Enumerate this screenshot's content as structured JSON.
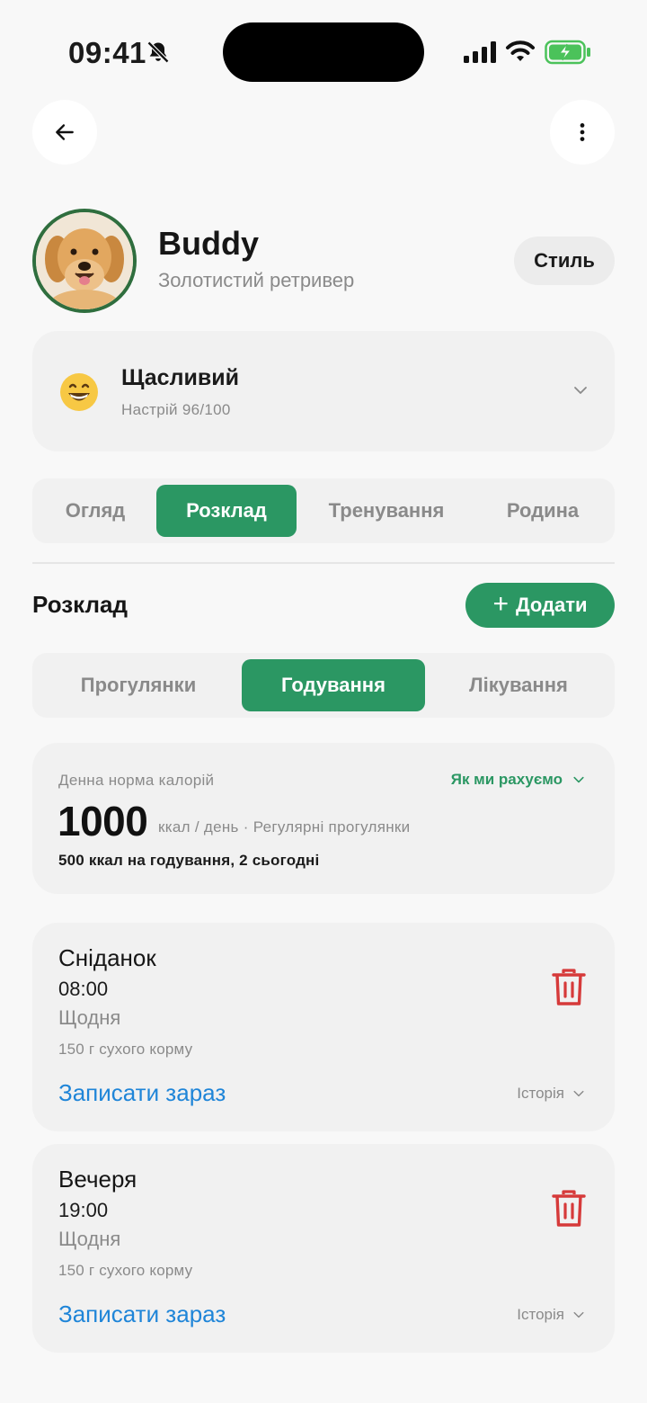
{
  "status": {
    "time": "09:41"
  },
  "pet": {
    "name": "Buddy",
    "breed": "Золотистий ретривер",
    "style_label": "Стиль"
  },
  "mood": {
    "emoji": "😄",
    "title": "Щасливий",
    "subtitle": "Настрій 96/100"
  },
  "main_tabs": [
    {
      "label": "Огляд",
      "active": false
    },
    {
      "label": "Розклад",
      "active": true
    },
    {
      "label": "Тренування",
      "active": false
    },
    {
      "label": "Родина",
      "active": false
    }
  ],
  "section": {
    "title": "Розклад",
    "add_label": "Додати"
  },
  "sub_tabs": [
    {
      "label": "Прогулянки",
      "active": false
    },
    {
      "label": "Годування",
      "active": true
    },
    {
      "label": "Лікування",
      "active": false
    }
  ],
  "calories": {
    "label": "Денна норма калорій",
    "how_link": "Як ми рахуємо",
    "value": "1000",
    "unit": "ккал / день · Регулярні прогулянки",
    "note": "500 ккал на годування, 2 сьогодні"
  },
  "feedings": [
    {
      "name": "Сніданок",
      "time": "08:00",
      "frequency": "Щодня",
      "amount": "150 г сухого корму",
      "log_label": "Записати зараз",
      "history_label": "Історія"
    },
    {
      "name": "Вечеря",
      "time": "19:00",
      "frequency": "Щодня",
      "amount": "150 г сухого корму",
      "log_label": "Записати зараз",
      "history_label": "Історія"
    }
  ],
  "colors": {
    "accent": "#2b9763",
    "link": "#1f85d8",
    "danger": "#d63a3a",
    "avatar_ring": "#2f6e3e"
  }
}
